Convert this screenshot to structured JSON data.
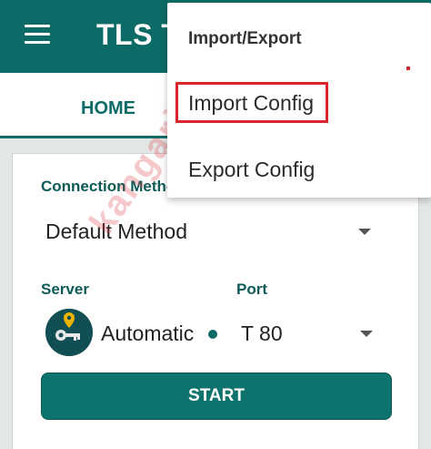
{
  "appbar": {
    "title": "TLS T"
  },
  "tabs": [
    {
      "label": "HOME"
    }
  ],
  "card": {
    "connection_label": "Connection Metho",
    "method_value": "Default Method",
    "server_label": "Server",
    "port_label": "Port",
    "server_value": "Automatic",
    "port_value": "T 80",
    "start_label": "START"
  },
  "popup": {
    "header": "Import/Export",
    "items": [
      {
        "label": "Import Config"
      },
      {
        "label": "Export Config"
      }
    ]
  },
  "watermark": "kangarif.net",
  "icons": {
    "menu": "hamburger-menu-icon",
    "server": "server-location-icon",
    "caret": "caret-down-icon"
  },
  "colors": {
    "primary": "#0c6b66",
    "highlight": "#d9262c"
  }
}
